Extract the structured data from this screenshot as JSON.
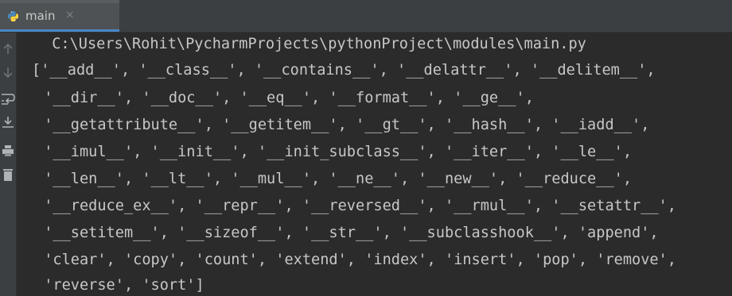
{
  "tab": {
    "label": "main",
    "close_glyph": "×",
    "icon": "python-icon"
  },
  "gutter": {
    "icons": [
      "arrow-up-icon",
      "arrow-down-icon",
      "soft-wrap-icon",
      "scroll-to-end-icon",
      "print-icon",
      "trash-icon"
    ]
  },
  "console": {
    "lines": [
      " C:\\Users\\Rohit\\PycharmProjects\\pythonProject\\modules\\main.py",
      "['__add__', '__class__', '__contains__', '__delattr__', '__delitem__',",
      " '__dir__', '__doc__', '__eq__', '__format__', '__ge__',",
      " '__getattribute__', '__getitem__', '__gt__', '__hash__', '__iadd__',",
      " '__imul__', '__init__', '__init_subclass__', '__iter__', '__le__',",
      " '__len__', '__lt__', '__mul__', '__ne__', '__new__', '__reduce__',",
      " '__reduce_ex__', '__repr__', '__reversed__', '__rmul__', '__setattr__',",
      " '__setitem__', '__sizeof__', '__str__', '__subclasshook__', 'append',",
      " 'clear', 'copy', 'count', 'extend', 'index', 'insert', 'pop', 'remove',",
      " 'reverse', 'sort']"
    ]
  },
  "colors": {
    "background": "#2b2b2b",
    "tabbar": "#3c3f41",
    "tab_active": "#4e5254",
    "tab_underline": "#4a88c7",
    "text": "#c7c7c7"
  }
}
